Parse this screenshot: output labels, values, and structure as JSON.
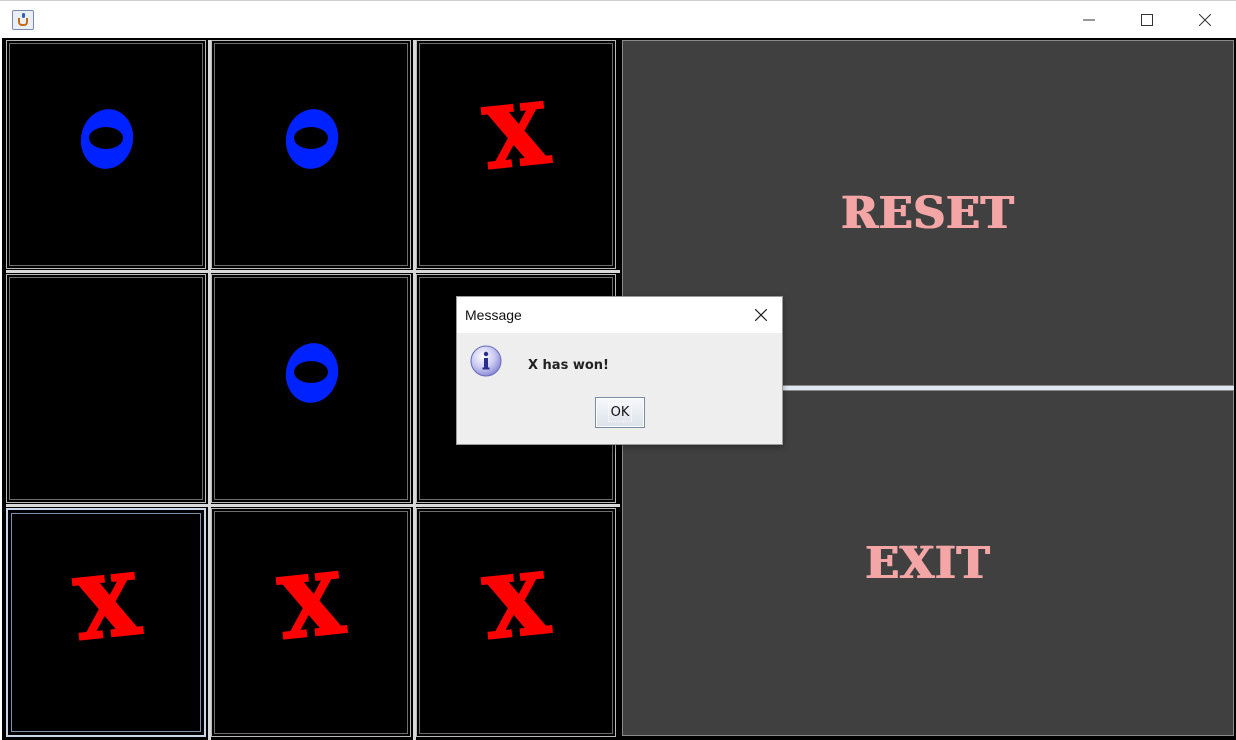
{
  "window": {
    "title": "",
    "icon": "java-cup-icon"
  },
  "board": {
    "cells": [
      "O",
      "O",
      "X",
      "",
      "O",
      "",
      "X",
      "X",
      "X"
    ],
    "x_color": "#ff0000",
    "o_color": "#0022ff",
    "cell_background": "#000000"
  },
  "side_panel": {
    "reset_label": "RESET",
    "exit_label": "EXIT",
    "label_color": "#f4a6a6",
    "button_background": "#404040"
  },
  "dialog": {
    "title": "Message",
    "message": "X has won!",
    "ok_label": "OK",
    "icon": "information-icon"
  }
}
